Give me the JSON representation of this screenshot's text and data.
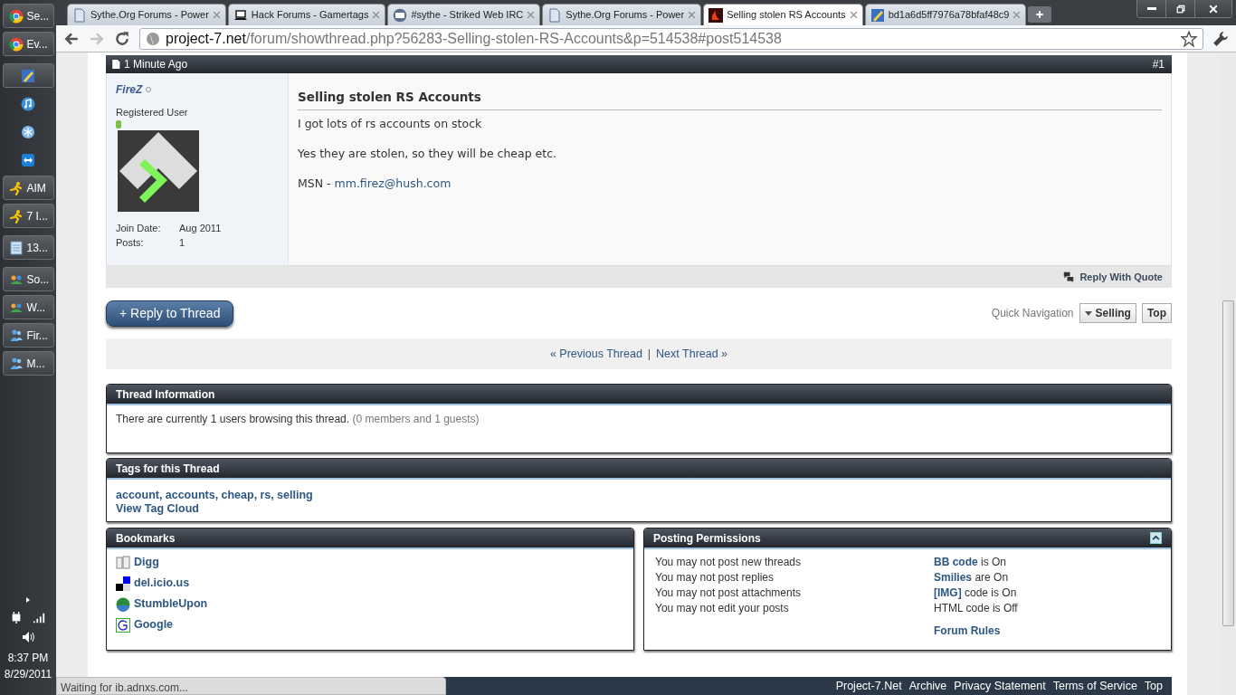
{
  "taskbar": {
    "items": [
      {
        "kind": "button",
        "label": "Se..."
      },
      {
        "kind": "button",
        "label": "Ev..."
      },
      {
        "kind": "button"
      },
      {
        "kind": "icon"
      },
      {
        "kind": "icon"
      },
      {
        "kind": "icon"
      },
      {
        "kind": "button",
        "label": "AIM"
      },
      {
        "kind": "button",
        "label": "7 I..."
      },
      {
        "kind": "button",
        "label": "13..."
      },
      {
        "kind": "button",
        "label": "So..."
      },
      {
        "kind": "button",
        "label": "W..."
      },
      {
        "kind": "button",
        "label": "Fir..."
      },
      {
        "kind": "button",
        "label": "M..."
      }
    ],
    "clock": {
      "time": "8:37 PM",
      "date": "8/29/2011"
    }
  },
  "browser": {
    "tabs": [
      {
        "title": "Sythe.Org Forums - Power",
        "selected": false
      },
      {
        "title": "Hack Forums - Gamertags",
        "selected": false
      },
      {
        "title": "#sythe - Striked Web IRC",
        "selected": false
      },
      {
        "title": "Sythe.Org Forums - Power",
        "selected": false
      },
      {
        "title": "Selling stolen RS Accounts",
        "selected": true
      },
      {
        "title": "bd1a6d5ff7976a78bfaf48c9",
        "selected": false
      }
    ],
    "forward_disabled": true,
    "address": {
      "host": "project-7.net",
      "path": "/forum/showthread.php?56283-Selling-stolen-RS-Accounts&p=514538#post514538"
    },
    "status": "Waiting for ib.adnxs.com..."
  },
  "post": {
    "time": "1 Minute Ago",
    "number": "#1",
    "author": {
      "name": "FireZ",
      "online": false,
      "title": "Registered User",
      "stats": [
        {
          "label": "Join Date:",
          "value": "Aug 2011"
        },
        {
          "label": "Posts:",
          "value": "1"
        }
      ]
    },
    "title": "Selling stolen RS Accounts",
    "paragraphs": [
      {
        "text": "I got lots of rs accounts on stock"
      },
      {
        "text": "Yes they are stolen, so they will be cheap etc."
      },
      {
        "text": "MSN -",
        "link": "mm.firez@hush.com"
      }
    ],
    "reply_quote": "Reply With Quote"
  },
  "thread_actions": {
    "reply_button": "+ Reply to Thread",
    "quick_nav_label": "Quick Navigation",
    "quick_nav_value": "Selling",
    "top_button": "Top"
  },
  "thread_nav": {
    "previous": "« Previous Thread",
    "separator": "|",
    "next": "Next Thread »"
  },
  "thread_info": {
    "title": "Thread Information",
    "text": "There are currently 1 users browsing this thread.",
    "detail": "(0 members and 1 guests)"
  },
  "tags": {
    "title": "Tags for this Thread",
    "tags": [
      "account",
      "accounts",
      "cheap",
      "rs",
      "selling"
    ],
    "separator": ",",
    "cloud_link": "View Tag Cloud"
  },
  "bookmarks": {
    "title": "Bookmarks",
    "items": [
      {
        "label": "Digg"
      },
      {
        "label": "del.icio.us"
      },
      {
        "label": "StumbleUpon"
      },
      {
        "label": "Google"
      }
    ]
  },
  "permissions": {
    "title": "Posting Permissions",
    "collapsed": false,
    "rules": [
      "You may not post new threads",
      "You may not post replies",
      "You may not post attachments",
      "You may not edit your posts"
    ],
    "settings": [
      {
        "link": "BB code",
        "text": "is On"
      },
      {
        "link": "Smilies",
        "text": "are On"
      },
      {
        "link": "[IMG]",
        "text": "code is On"
      },
      {
        "text": "HTML code is Off"
      }
    ],
    "rules_link": "Forum Rules"
  },
  "footer": {
    "links": [
      "Project-7.Net",
      "Archive",
      "Privacy Statement",
      "Terms of Service",
      "Top"
    ]
  }
}
